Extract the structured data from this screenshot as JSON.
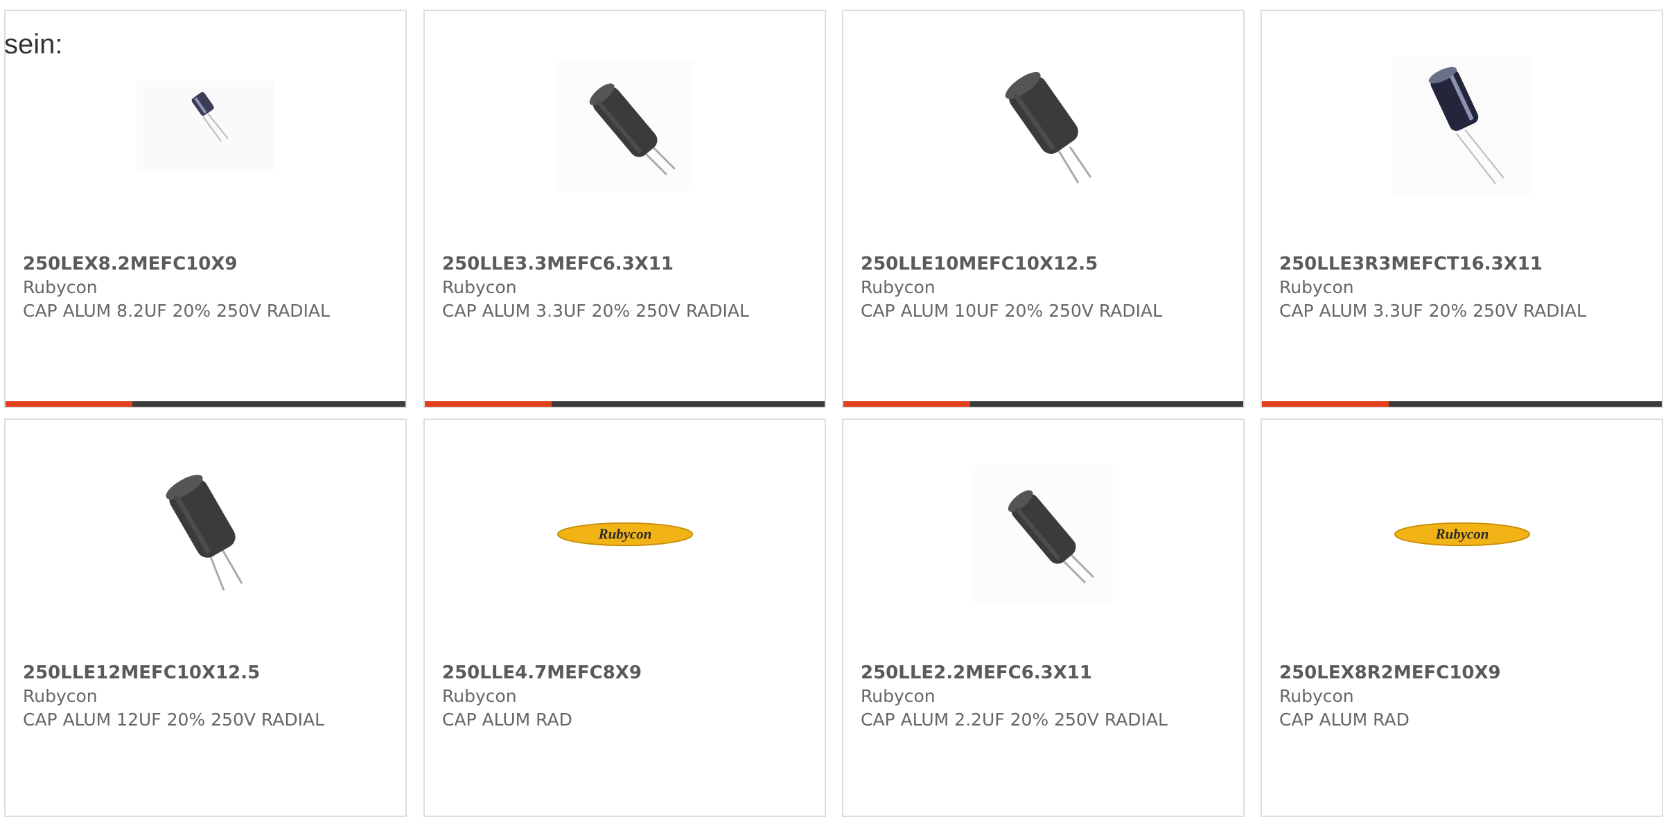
{
  "intro_text": "sein:",
  "products": [
    {
      "part_number": "250LEX8.2MEFC10X9",
      "manufacturer": "Rubycon",
      "description": "CAP ALUM 8.2UF 20% 250V RADIAL",
      "image": "small-capacitor-image"
    },
    {
      "part_number": "250LLE3.3MEFC6.3X11",
      "manufacturer": "Rubycon",
      "description": "CAP ALUM 3.3UF 20% 250V RADIAL",
      "image": "capacitor-image"
    },
    {
      "part_number": "250LLE10MEFC10X12.5",
      "manufacturer": "Rubycon",
      "description": "CAP ALUM 10UF 20% 250V RADIAL",
      "image": "capacitor-image"
    },
    {
      "part_number": "250LLE3R3MEFCT16.3X11",
      "manufacturer": "Rubycon",
      "description": "CAP ALUM 3.3UF 20% 250V RADIAL",
      "image": "capacitor-image"
    },
    {
      "part_number": "250LLE12MEFC10X12.5",
      "manufacturer": "Rubycon",
      "description": "CAP ALUM 12UF 20% 250V RADIAL",
      "image": "capacitor-image"
    },
    {
      "part_number": "250LLE4.7MEFC8X9",
      "manufacturer": "Rubycon",
      "description": "CAP ALUM RAD",
      "image": "rubycon-logo",
      "logo_text": "Rubycon"
    },
    {
      "part_number": "250LLE2.2MEFC6.3X11",
      "manufacturer": "Rubycon",
      "description": "CAP ALUM 2.2UF 20% 250V RADIAL",
      "image": "capacitor-image"
    },
    {
      "part_number": "250LEX8R2MEFC10X9",
      "manufacturer": "Rubycon",
      "description": "CAP ALUM RAD",
      "image": "rubycon-logo",
      "logo_text": "Rubycon"
    }
  ],
  "colors": {
    "accent": "#e0401b",
    "bar": "#3c3c3c",
    "logo_fill": "#f2b316"
  }
}
